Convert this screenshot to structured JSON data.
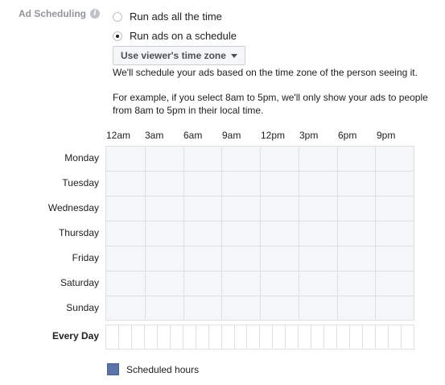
{
  "section": {
    "label": "Ad Scheduling",
    "info_icon": "info-icon"
  },
  "options": [
    {
      "label": "Run ads all the time",
      "checked": false
    },
    {
      "label": "Run ads on a schedule",
      "checked": true
    }
  ],
  "timezone": {
    "label": "Use viewer's time zone"
  },
  "help": {
    "line1": "We'll schedule your ads based on the time zone of the person seeing it.",
    "line2": "For example, if you select 8am to 5pm, we'll only show your ads to people from 8am to 5pm in their local time."
  },
  "hours": [
    "12am",
    "3am",
    "6am",
    "9am",
    "12pm",
    "3pm",
    "6pm",
    "9pm"
  ],
  "days": [
    "Monday",
    "Tuesday",
    "Wednesday",
    "Thursday",
    "Friday",
    "Saturday",
    "Sunday"
  ],
  "every_day": "Every Day",
  "legend": {
    "label": "Scheduled hours",
    "color": "#5b73a8"
  },
  "colors": {
    "grid_bg": "#f5f6f7",
    "grid_line": "#dddfe2",
    "scheduled": "#5b73a8"
  }
}
